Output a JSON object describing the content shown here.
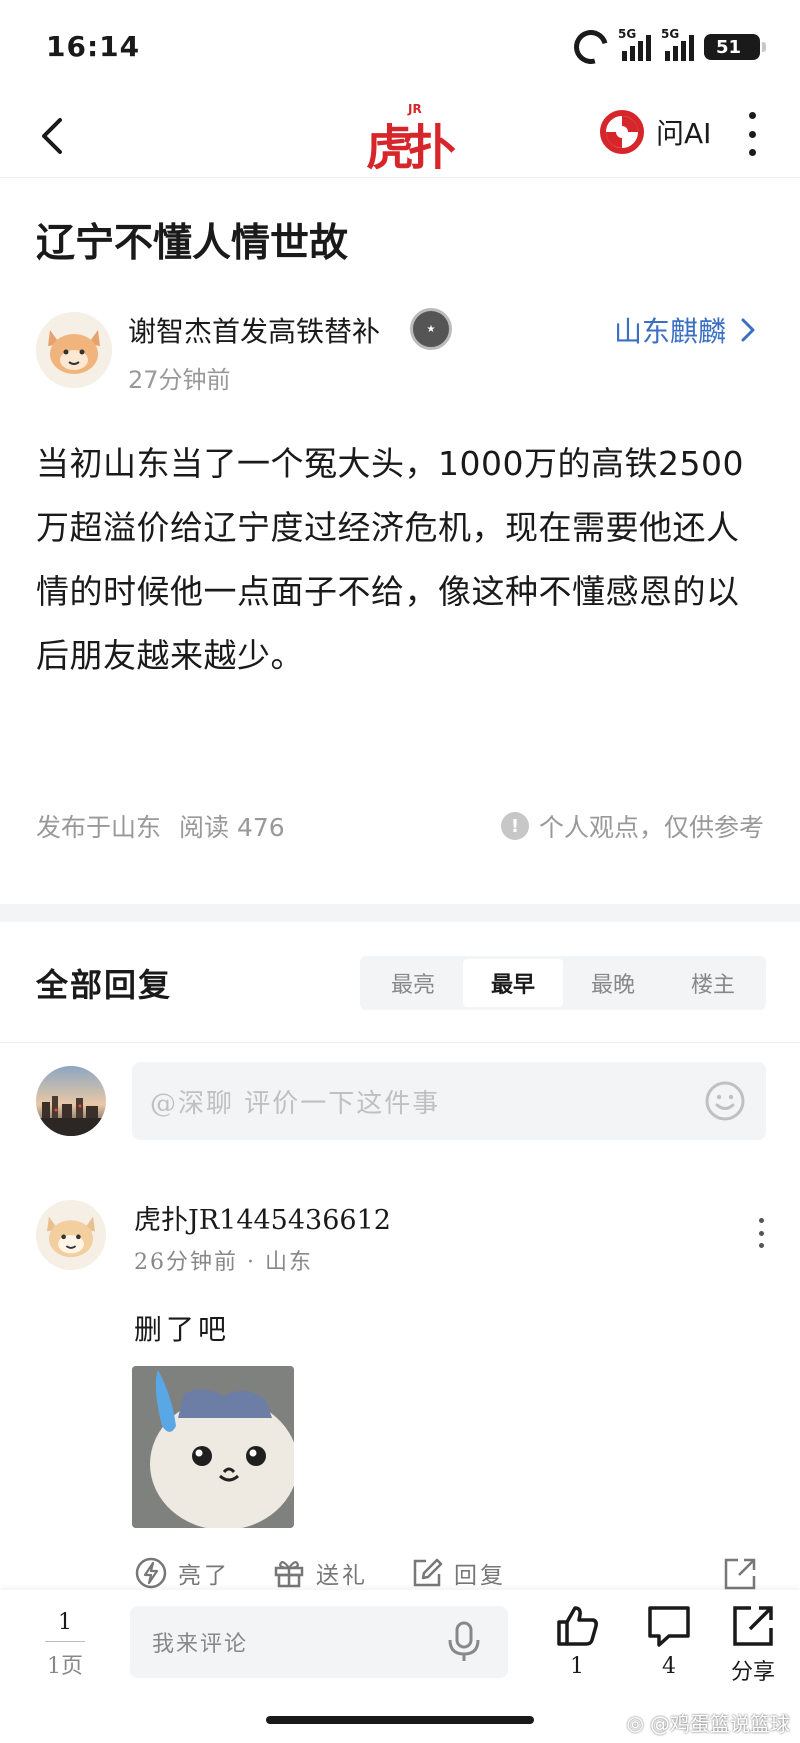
{
  "status_bar": {
    "time": "16:14",
    "network": "5G",
    "battery": "51"
  },
  "header": {
    "logo_text": "虎扑",
    "logo_tag": "JR",
    "ai_label": "问AI"
  },
  "post": {
    "title": "辽宁不懂人情世故",
    "author": "谢智杰首发高铁替补",
    "time": "27分钟前",
    "board": "山东麒麟",
    "body": "当初山东当了一个冤大头，1000万的高铁2500万超溢价给辽宁度过经济危机，现在需要他还人情的时候他一点面子不给，像这种不懂感恩的以后朋友越来越少。",
    "location": "发布于山东",
    "reads": "阅读 476",
    "disclaimer": "个人观点，仅供参考"
  },
  "replies": {
    "title": "全部回复",
    "sort_tabs": [
      {
        "label": "最亮"
      },
      {
        "label": "最早"
      },
      {
        "label": "最晚"
      },
      {
        "label": "楼主"
      }
    ],
    "active_tab": "最早",
    "composer_placeholder": "@深聊 评价一下这件事",
    "items": [
      {
        "user": "虎扑JR1445436612",
        "meta": "26分钟前 · 山东",
        "text": "删了吧",
        "actions": {
          "light": "亮了",
          "gift": "送礼",
          "reply": "回复"
        }
      }
    ]
  },
  "bottom_bar": {
    "page_current": "1",
    "page_total": "1页",
    "input_placeholder": "我来评论",
    "likes": "1",
    "comments": "4",
    "share": "分享"
  },
  "watermark": "@鸡蛋篮说篮球",
  "colors": {
    "brand_red": "#d6262b",
    "link_blue": "#3a6fc4"
  }
}
